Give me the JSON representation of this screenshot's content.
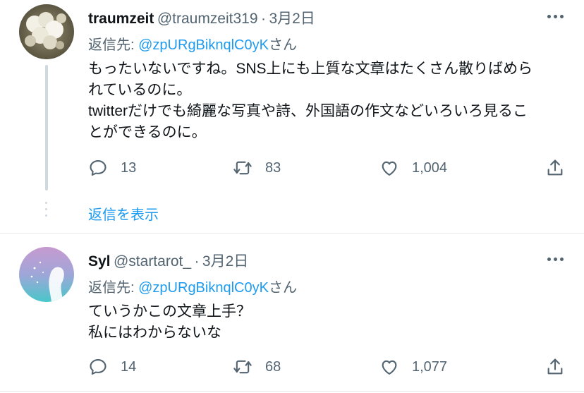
{
  "tweets": [
    {
      "name": "traumzeit",
      "handle": "@traumzeit319",
      "dot": "·",
      "date": "3月2日",
      "reply_prefix": "返信先: ",
      "reply_to": "@zpURgBiknqlC0yK",
      "reply_suffix": "さん",
      "lines": [
        "もったいないですね。SNS上にも上質な文章はたくさん散りばめら",
        "れているのに。",
        "twitterだけでも綺麗な写真や詩、外国語の作文などいろいろ見るこ",
        "とができるのに。"
      ],
      "replies": "13",
      "retweets": "83",
      "likes": "1,004"
    },
    {
      "name": "Syl",
      "handle": "@startarot_",
      "dot": "·",
      "date": "3月2日",
      "reply_prefix": "返信先: ",
      "reply_to": "@zpURgBiknqlC0yK",
      "reply_suffix": "さん",
      "lines": [
        "ていうかこの文章上手？",
        "私にはわからないな"
      ],
      "replies": "14",
      "retweets": "68",
      "likes": "1,077"
    }
  ],
  "show_replies_label": "返信を表示",
  "icons": {
    "reply": "reply-icon",
    "retweet": "retweet-icon",
    "like": "like-icon",
    "share": "share-icon",
    "more": "more-icon"
  },
  "colors": {
    "accent": "#1d9bf0",
    "muted": "#536471",
    "text": "#0f1419"
  }
}
